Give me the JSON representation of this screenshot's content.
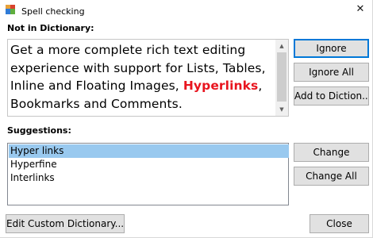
{
  "window": {
    "title": "Spell checking",
    "close_glyph": "✕",
    "app_icon": "app-icon"
  },
  "not_in_dictionary": {
    "label": "Not in Dictionary:",
    "lines": [
      "Get a more complete rich text editing",
      "experience with support for Lists, Tables,",
      "Inline and Floating Images, ",
      ",",
      "Bookmarks and Comments."
    ],
    "misspelled_word": "Hyperlinks",
    "misspelled_color": "#e8141e"
  },
  "right_buttons": {
    "ignore": "Ignore",
    "ignore_all": "Ignore All",
    "add_to_dictionary": "Add to Diction..."
  },
  "suggestions": {
    "label": "Suggestions:",
    "items": [
      "Hyper links",
      "Hyperfine",
      "Interlinks"
    ],
    "selected_index": 0,
    "selected_color": "#99c9ef"
  },
  "suggestion_buttons": {
    "change": "Change",
    "change_all": "Change All"
  },
  "footer": {
    "edit_custom_dictionary": "Edit Custom Dictionary...",
    "close": "Close"
  }
}
